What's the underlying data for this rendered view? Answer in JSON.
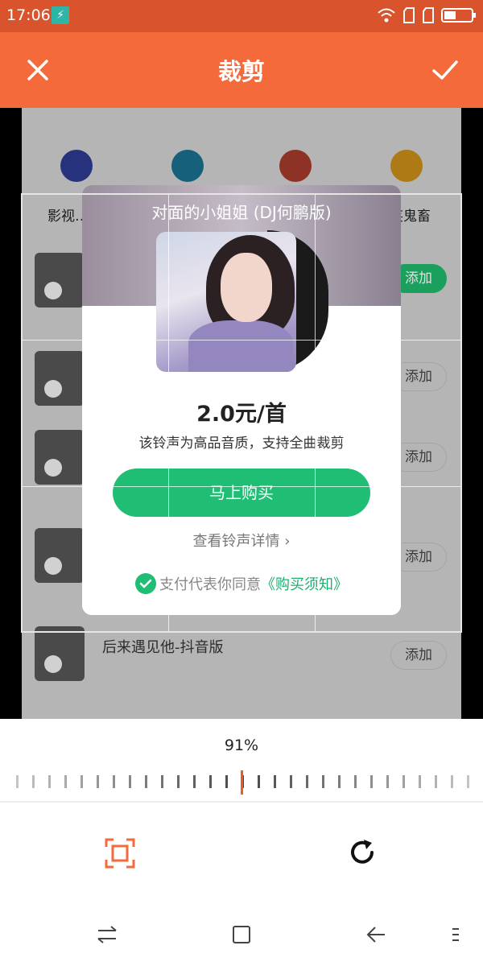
{
  "status": {
    "time": "17:06"
  },
  "header": {
    "title": "裁剪"
  },
  "background": {
    "category_labels": [
      "影视…",
      "…笑鬼畜"
    ],
    "rows": [
      {
        "song": "",
        "button": "添加"
      },
      {
        "song": "",
        "button": "添加"
      },
      {
        "song": "",
        "button": "添加"
      },
      {
        "song": "",
        "button": "添加"
      },
      {
        "song": "后来遇见他-抖音版",
        "button": "添加"
      }
    ]
  },
  "dialog": {
    "song_title": "对面的小姐姐 (DJ何鹏版)",
    "price": "2.0元/首",
    "description": "该铃声为高品音质，支持全曲裁剪",
    "buy_button": "马上购买",
    "detail_link": "查看铃声详情 ›",
    "agree_text": "支付代表你同意",
    "agree_link": "《购买须知》"
  },
  "editor": {
    "zoom_label": "91%",
    "zoom_percent": 91
  },
  "colors": {
    "accent": "#f46a3b",
    "status_bar": "#d9542c",
    "green": "#1fbe74",
    "ruler_marker": "#f15a22"
  },
  "icons": {
    "close": "close-icon",
    "confirm": "check-icon",
    "crop": "crop-frame-icon",
    "rotate": "rotate-icon"
  }
}
